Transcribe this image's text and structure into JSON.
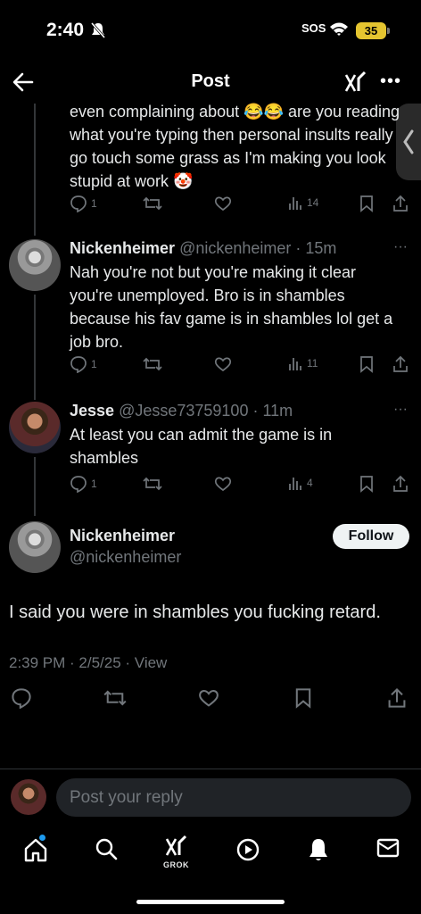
{
  "status_bar": {
    "time": "2:40",
    "sos": "SOS",
    "battery": "35"
  },
  "header": {
    "title": "Post"
  },
  "replies": [
    {
      "text": "even complaining about 😂😂 are you reading what you're typing then personal insults really go touch some grass as I'm making you look stupid at work 🤡",
      "replies_count": "1",
      "views": "14"
    },
    {
      "name": "Nickenheimer",
      "handle": "@nickenheimer",
      "time": "15m",
      "text": "Nah you're not but you're making it clear you're unemployed. Bro is in shambles because his fav game is in shambles lol get a job bro.",
      "replies_count": "1",
      "views": "11"
    },
    {
      "name": "Jesse",
      "handle": "@Jesse73759100",
      "time": "11m",
      "text": "At least you can admit the game is in shambles",
      "replies_count": "1",
      "views": "4"
    }
  ],
  "main_post": {
    "name": "Nickenheimer",
    "handle": "@nickenheimer",
    "follow_label": "Follow",
    "text": "I said you were in shambles you fucking retard.",
    "timestamp": "2:39 PM · 2/5/25 · View"
  },
  "composer": {
    "placeholder": "Post your reply"
  },
  "bottom_nav": {
    "grok_label": "GROK"
  },
  "colors": {
    "background": "#000000",
    "text": "#e7e9ea",
    "muted": "#71767b",
    "accent": "#1d9bf0",
    "battery": "#e5c530"
  },
  "icons": [
    "back-arrow-icon",
    "grok-icon",
    "more-icon",
    "reply-icon",
    "repost-icon",
    "like-icon",
    "views-icon",
    "bookmark-icon",
    "share-icon",
    "home-icon",
    "search-icon",
    "play-icon",
    "bell-icon",
    "mail-icon"
  ]
}
